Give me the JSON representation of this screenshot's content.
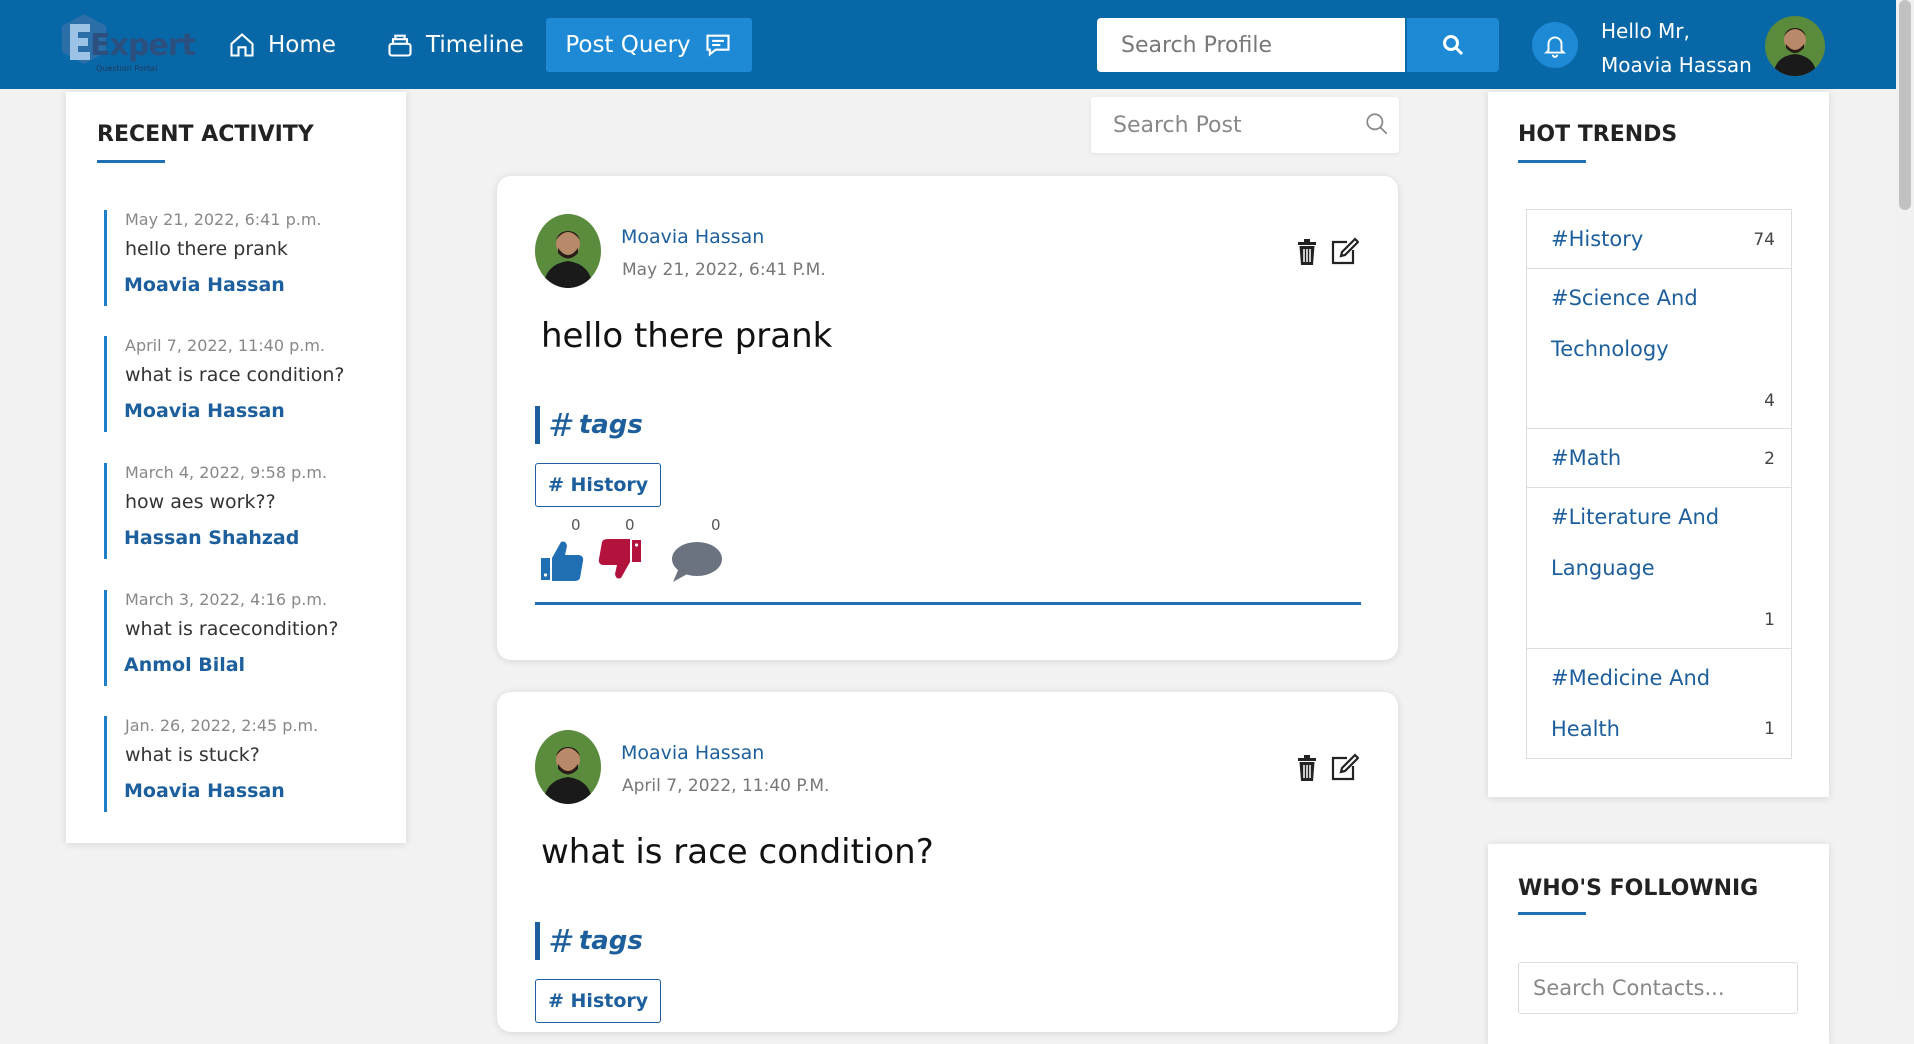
{
  "app": {
    "logo_word": "Expert",
    "logo_sub": "Question Portal"
  },
  "nav": {
    "home": "Home",
    "timeline": "Timeline",
    "post_query": "Post Query"
  },
  "search": {
    "profile_placeholder": "Search Profile",
    "post_placeholder": "Search Post"
  },
  "user": {
    "greeting": "Hello Mr,",
    "name": "Moavia Hassan"
  },
  "recent_activity": {
    "title": "RECENT ACTIVITY",
    "items": [
      {
        "date": "May 21, 2022, 6:41 p.m.",
        "text": "hello there prank",
        "user": "Moavia Hassan"
      },
      {
        "date": "April 7, 2022, 11:40 p.m.",
        "text": "what is race condition?",
        "user": "Moavia Hassan"
      },
      {
        "date": "March 4, 2022, 9:58 p.m.",
        "text": "how aes work??",
        "user": "Hassan Shahzad"
      },
      {
        "date": "March 3, 2022, 4:16 p.m.",
        "text": "what is racecondition?",
        "user": "Anmol Bilal"
      },
      {
        "date": "Jan. 26, 2022, 2:45 p.m.",
        "text": "what is stuck?",
        "user": "Moavia Hassan"
      }
    ]
  },
  "posts": [
    {
      "author": "Moavia Hassan",
      "date": "May 21, 2022, 6:41 P.M.",
      "text": "hello there prank",
      "tags_label": "tags",
      "tags": [
        "# History"
      ],
      "likes": "0",
      "dislikes": "0",
      "comments": "0"
    },
    {
      "author": "Moavia Hassan",
      "date": "April 7, 2022, 11:40 P.M.",
      "text": "what is race condition?",
      "tags_label": "tags",
      "tags": [
        "# History"
      ]
    }
  ],
  "hot_trends": {
    "title": "HOT TRENDS",
    "items": [
      {
        "name": "#History",
        "count": "74"
      },
      {
        "name": "#Science And Technology",
        "count": "4"
      },
      {
        "name": "#Math",
        "count": "2"
      },
      {
        "name": "#Literature And Language",
        "count": "1"
      },
      {
        "name": "#Medicine And Health",
        "count": "1"
      }
    ]
  },
  "following": {
    "title": "WHO'S FOLLOWNIG",
    "search_placeholder": "Search Contacts..."
  },
  "colors": {
    "topbar": "#0868a7",
    "accent": "#1e8ad6",
    "link": "#1d5f9c",
    "like": "#1f6fb2",
    "dislike": "#b3123c",
    "comment": "#6b7280"
  }
}
